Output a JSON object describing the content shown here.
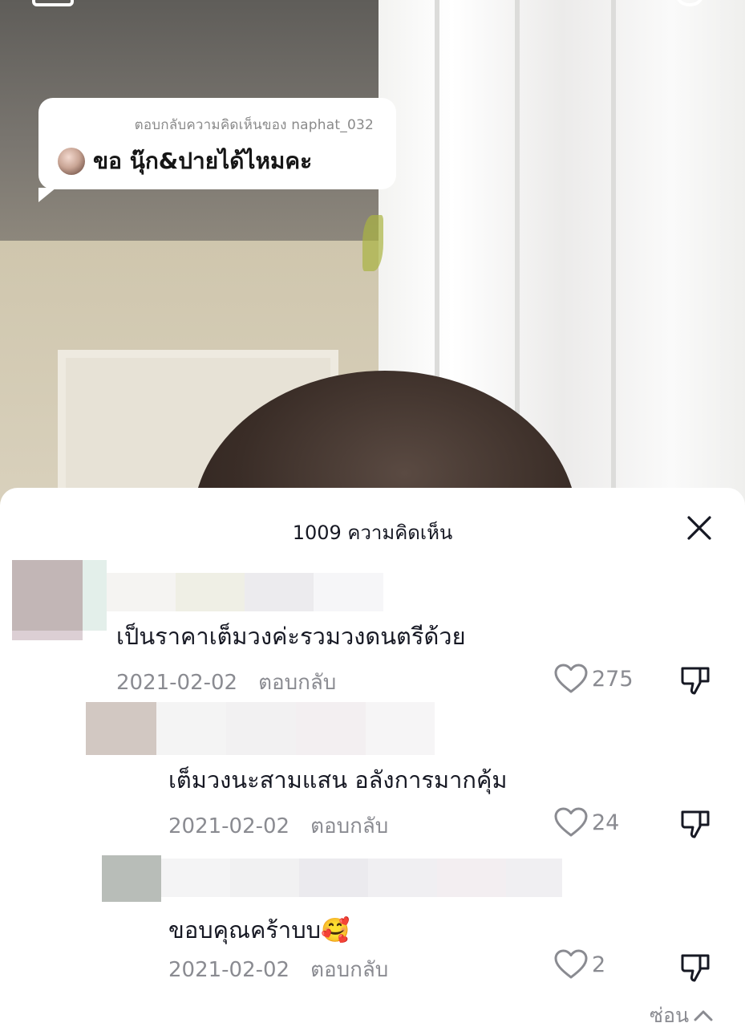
{
  "video": {
    "reply_label": "ตอบกลับความคิดเห็นของ naphat_032",
    "reply_comment": "ขอ นุ๊ก&ปายได้ไหมคะ"
  },
  "sheet": {
    "title": "1009 ความคิดเห็น",
    "hide_label": "ซ่อน"
  },
  "comments": [
    {
      "text": "เป็นราคาเต็มวงค่ะรวมวงดนตรีด้วย",
      "date": "2021-02-02",
      "reply_label": "ตอบกลับ",
      "likes": "275"
    },
    {
      "text": "เต็มวงนะสามแสน อลังการมากคุ้ม",
      "date": "2021-02-02",
      "reply_label": "ตอบกลับ",
      "likes": "24"
    },
    {
      "text": "ขอบคุณคร้าบบ🥰",
      "date": "2021-02-02",
      "reply_label": "ตอบกลับ",
      "likes": "2"
    }
  ],
  "icons": {
    "close": "close-icon",
    "like": "heart-outline-icon",
    "dislike": "thumbs-down-icon",
    "collapse": "chevron-up-icon"
  }
}
